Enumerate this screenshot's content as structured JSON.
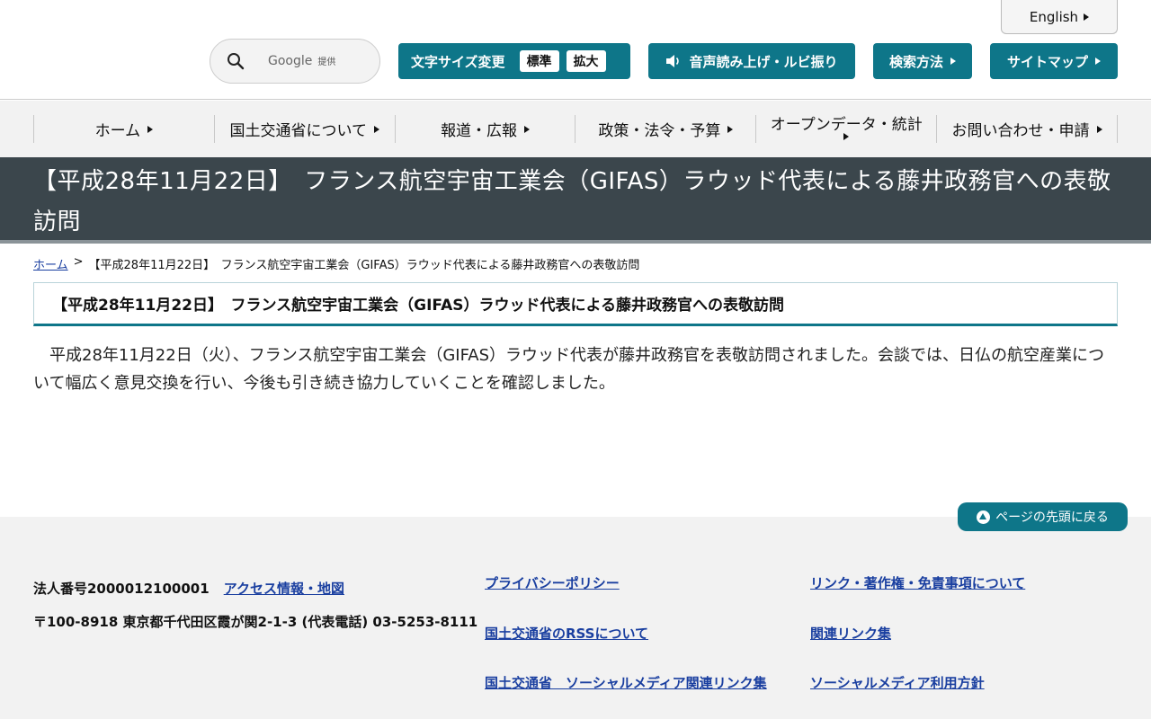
{
  "header": {
    "english_label": "English",
    "search_placeholder_brand": "Google",
    "search_placeholder_suffix": "提供",
    "font_size": {
      "label": "文字サイズ変更",
      "standard": "標準",
      "large": "拡大"
    },
    "voice_label": "音声読み上げ・ルビ振り",
    "search_howto_label": "検索方法",
    "sitemap_label": "サイトマップ"
  },
  "gnav": {
    "items": [
      {
        "label": "ホーム"
      },
      {
        "label": "国土交通省について"
      },
      {
        "label": "報道・広報"
      },
      {
        "label": "政策・法令・予算"
      },
      {
        "label": "オープンデータ・統計"
      },
      {
        "label": "お問い合わせ・申請"
      }
    ]
  },
  "page": {
    "title": "【平成28年11月22日】　フランス航空宇宙工業会（GIFAS）ラウッド代表による藤井政務官への表敬訪問",
    "breadcrumb": {
      "home": "ホーム",
      "separator": ">",
      "current": "【平成28年11月22日】　フランス航空宇宙工業会（GIFAS）ラウッド代表による藤井政務官への表敬訪問"
    },
    "section_heading": "【平成28年11月22日】　フランス航空宇宙工業会（GIFAS）ラウッド代表による藤井政務官への表敬訪問",
    "body": "平成28年11月22日（火）、フランス航空宇宙工業会（GIFAS）ラウッド代表が藤井政務官を表敬訪問されました。会談では、日仏の航空産業について幅広く意見交換を行い、今後も引き続き協力していくことを確認しました。"
  },
  "footer": {
    "pagetop_label": "ページの先頭に戻る",
    "corp_number": "法人番号2000012100001",
    "access_link": "アクセス情報・地図",
    "address": "〒100-8918 東京都千代田区霞が関2-1-3 (代表電話) 03-5253-8111",
    "links": {
      "privacy": "プライバシーポリシー",
      "rss": "国土交通省のRSSについて",
      "social_links": "国土交通省　ソーシャルメディア関連リンク集",
      "copyright": "リンク・著作権・免責事項について",
      "related": "関連リンク集",
      "social_policy": "ソーシャルメディア利用方針"
    }
  },
  "colors": {
    "accent_teal": "#0e7689",
    "title_band": "#3b464c",
    "link_blue": "#1a3fa0"
  }
}
